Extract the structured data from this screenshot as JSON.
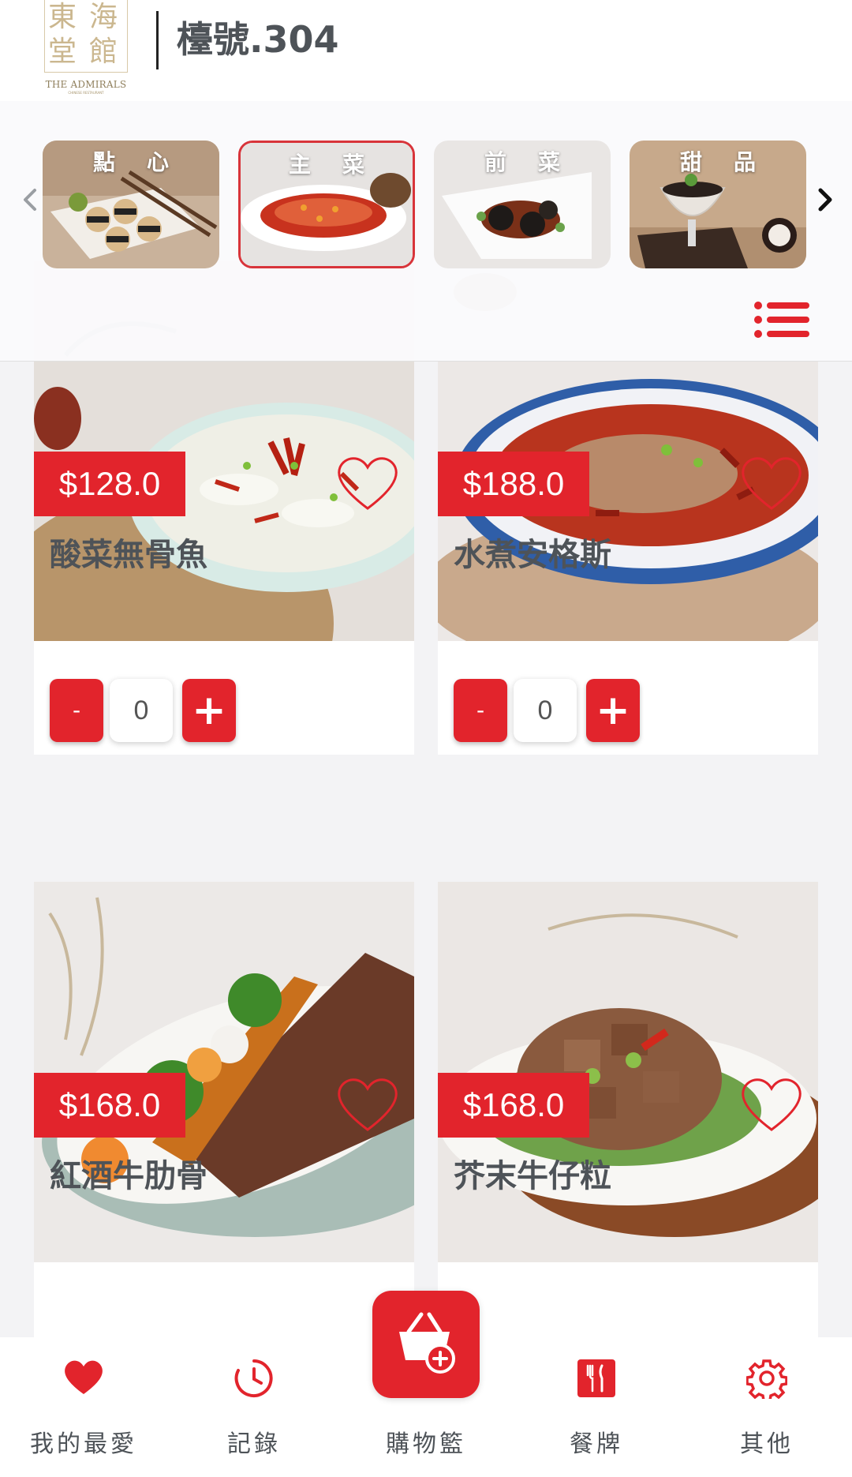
{
  "header": {
    "logo_glyphs": [
      "東",
      "海",
      "堂",
      "館"
    ],
    "logo_name": "THE ADMIRALS",
    "logo_sub": "CHINESE RESTAURANT",
    "table_label": "檯號.304"
  },
  "categories": [
    {
      "label": "點心",
      "active": false
    },
    {
      "label": "主菜",
      "active": true
    },
    {
      "label": "前菜",
      "active": false
    },
    {
      "label": "甜品",
      "active": false
    }
  ],
  "dishes": [
    {
      "name": "酸菜無骨魚",
      "price": "$128.0",
      "qty": "0"
    },
    {
      "name": "水煮安格斯",
      "price": "$188.0",
      "qty": "0"
    },
    {
      "name": "紅酒牛肋骨",
      "price": "$168.0",
      "qty": ""
    },
    {
      "name": "芥末牛仔粒",
      "price": "$168.0",
      "qty": ""
    }
  ],
  "qty_controls": {
    "minus": "-",
    "plus": "+"
  },
  "nav": {
    "favorites": "我的最愛",
    "history": "記錄",
    "cart": "購物籃",
    "menu": "餐牌",
    "other": "其他"
  },
  "colors": {
    "accent": "#e2242c",
    "text": "#4e5358",
    "gold": "#cbb78f"
  },
  "icons": {
    "prev": "chevron-left-icon",
    "next": "chevron-right-icon",
    "list": "list-icon",
    "favorite": "heart-outline-icon",
    "nav_favorites": "heart-icon",
    "nav_history": "clock-icon",
    "nav_cart": "basket-plus-icon",
    "nav_menu": "cutlery-icon",
    "nav_other": "gear-icon"
  }
}
